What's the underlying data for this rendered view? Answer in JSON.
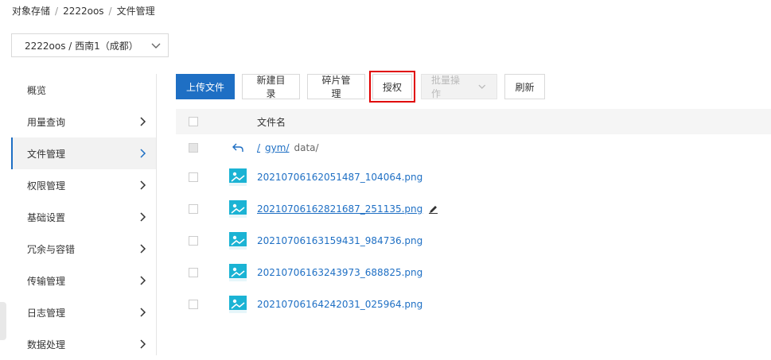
{
  "breadcrumb": {
    "items": [
      "对象存储",
      "2222oos",
      "文件管理"
    ],
    "separator": "/"
  },
  "bucket_select": {
    "value": "2222oos / 西南1（成都）"
  },
  "sidebar": {
    "items": [
      {
        "label": "概览",
        "has_arrow": false,
        "active": false
      },
      {
        "label": "用量查询",
        "has_arrow": true,
        "active": false
      },
      {
        "label": "文件管理",
        "has_arrow": true,
        "active": true
      },
      {
        "label": "权限管理",
        "has_arrow": true,
        "active": false
      },
      {
        "label": "基础设置",
        "has_arrow": true,
        "active": false
      },
      {
        "label": "冗余与容错",
        "has_arrow": true,
        "active": false
      },
      {
        "label": "传输管理",
        "has_arrow": true,
        "active": false
      },
      {
        "label": "日志管理",
        "has_arrow": true,
        "active": false
      },
      {
        "label": "数据处理",
        "has_arrow": true,
        "active": false
      }
    ]
  },
  "toolbar": {
    "upload": "上传文件",
    "new_dir": "新建目录",
    "fragments": "碎片管理",
    "authorize": "授权",
    "batch": "批量操作",
    "refresh": "刷新"
  },
  "table": {
    "header_name": "文件名",
    "path": {
      "root": "/",
      "link": "gym/",
      "current": "data/"
    },
    "files": [
      "20210706162051487_104064.png",
      "20210706162821687_251135.png",
      "20210706163159431_984736.png",
      "20210706163243973_688825.png",
      "20210706164242031_025964.png"
    ]
  },
  "colors": {
    "primary": "#1e6fc4",
    "highlight": "#e00000",
    "icon": "#1bb3d4"
  }
}
